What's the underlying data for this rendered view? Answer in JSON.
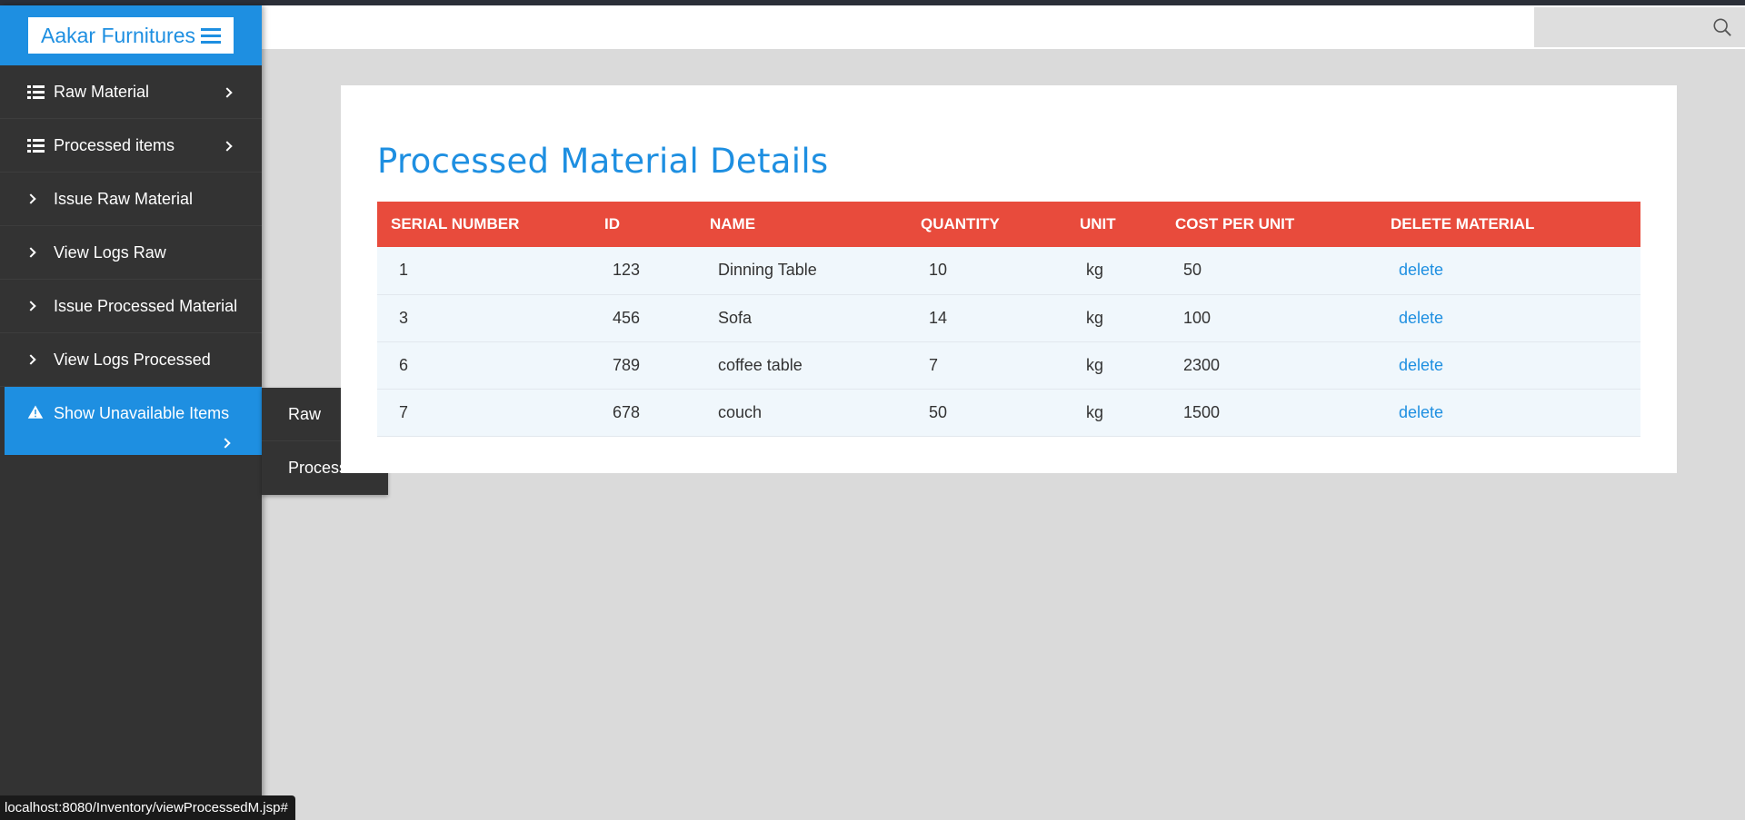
{
  "brand": {
    "title": "Aakar Furnitures"
  },
  "sidebar": {
    "items": [
      {
        "label": "Raw Material"
      },
      {
        "label": "Processed items"
      },
      {
        "label": "Issue Raw Material"
      },
      {
        "label": "View Logs Raw"
      },
      {
        "label": "Issue Processed Material"
      },
      {
        "label": "View Logs Processed"
      },
      {
        "label": "Show Unavailable Items"
      }
    ],
    "flyout": [
      {
        "label": "Raw"
      },
      {
        "label": "Processed"
      }
    ]
  },
  "main": {
    "title": "Processed Material Details",
    "table": {
      "headers": [
        "SERIAL NUMBER",
        "ID",
        "NAME",
        "QUANTITY",
        "UNIT",
        "COST PER UNIT",
        "DELETE MATERIAL"
      ],
      "rows": [
        [
          "1",
          "123",
          "Dinning Table",
          "10",
          "kg",
          "50",
          "delete"
        ],
        [
          "3",
          "456",
          "Sofa",
          "14",
          "kg",
          "100",
          "delete"
        ],
        [
          "6",
          "789",
          "coffee table",
          "7",
          "kg",
          "2300",
          "delete"
        ],
        [
          "7",
          "678",
          "couch",
          "50",
          "kg",
          "1500",
          "delete"
        ]
      ]
    }
  },
  "status_bar": {
    "url": "localhost:8080/Inventory/viewProcessedM.jsp#"
  },
  "colors": {
    "accent": "#1e8fe1",
    "table_header": "#e84b3c",
    "sidebar": "#333333"
  }
}
